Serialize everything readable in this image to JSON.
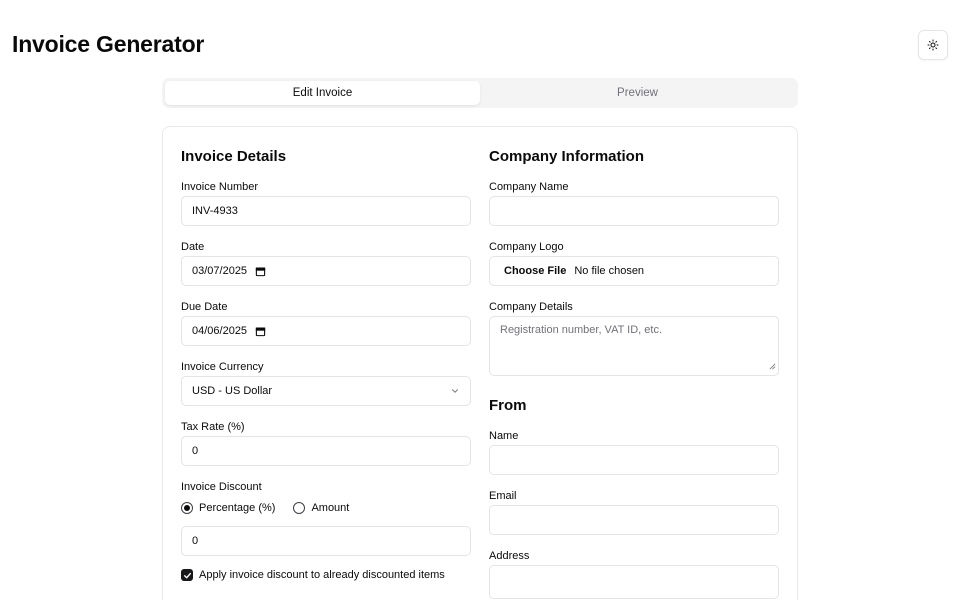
{
  "app": {
    "title": "Invoice Generator"
  },
  "tabs": [
    {
      "label": "Edit Invoice",
      "active": true
    },
    {
      "label": "Preview",
      "active": false
    }
  ],
  "invoice_details": {
    "title": "Invoice Details",
    "invoice_number": {
      "label": "Invoice Number",
      "value": "INV-4933"
    },
    "date": {
      "label": "Date",
      "value": "03/07/2025"
    },
    "due_date": {
      "label": "Due Date",
      "value": "04/06/2025"
    },
    "currency": {
      "label": "Invoice Currency",
      "value": "USD - US Dollar"
    },
    "tax_rate": {
      "label": "Tax Rate (%)",
      "value": "0"
    },
    "discount": {
      "label": "Invoice Discount",
      "options": [
        {
          "label": "Percentage (%)",
          "checked": true
        },
        {
          "label": "Amount",
          "checked": false
        }
      ],
      "value": "0",
      "apply_label": "Apply invoice discount to already discounted items",
      "apply_checked": true
    }
  },
  "company": {
    "title": "Company Information",
    "name": {
      "label": "Company Name",
      "value": ""
    },
    "logo": {
      "label": "Company Logo",
      "button": "Choose File",
      "status": "No file chosen"
    },
    "details": {
      "label": "Company Details",
      "placeholder": "Registration number, VAT ID, etc."
    }
  },
  "from": {
    "title": "From",
    "name": {
      "label": "Name",
      "value": ""
    },
    "email": {
      "label": "Email",
      "value": ""
    },
    "address": {
      "label": "Address",
      "value": ""
    }
  },
  "colors": {
    "accent": "#18181b",
    "border": "#e4e4e7",
    "muted": "#71717a",
    "tab_bg": "#f4f4f5"
  },
  "icons": {
    "theme_toggle": "sun-icon",
    "date": "calendar-icon",
    "select": "chevron-down-icon",
    "checkbox": "check-icon"
  }
}
